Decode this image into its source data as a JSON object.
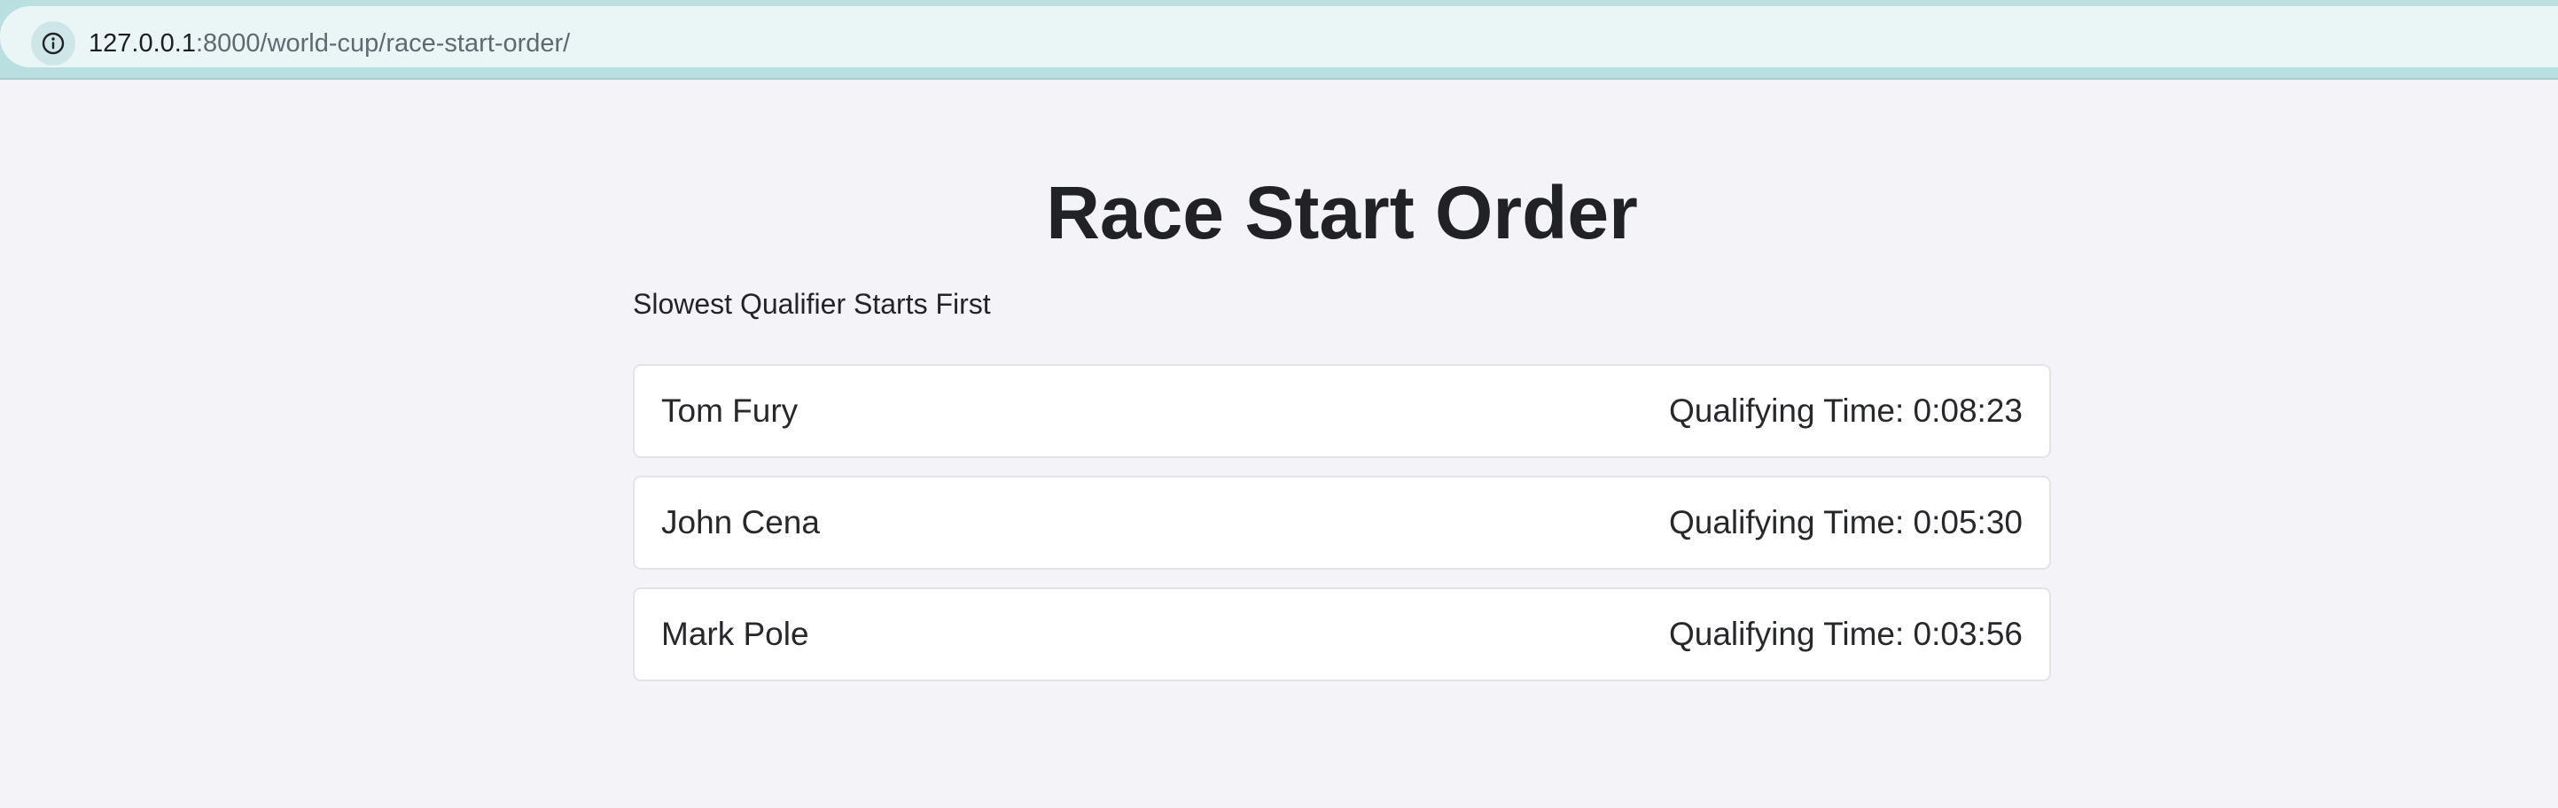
{
  "browser": {
    "url_host": "127.0.0.1",
    "url_path": ":8000/world-cup/race-start-order/",
    "site_info_icon": "info-circle-icon"
  },
  "page": {
    "title": "Race Start Order",
    "subtitle": "Slowest Qualifier Starts First",
    "racers": [
      {
        "name": "Tom Fury",
        "time_text": "Qualifying Time: 0:08:23"
      },
      {
        "name": "John Cena",
        "time_text": "Qualifying Time: 0:05:30"
      },
      {
        "name": "Mark Pole",
        "time_text": "Qualifying Time: 0:03:56"
      }
    ]
  }
}
